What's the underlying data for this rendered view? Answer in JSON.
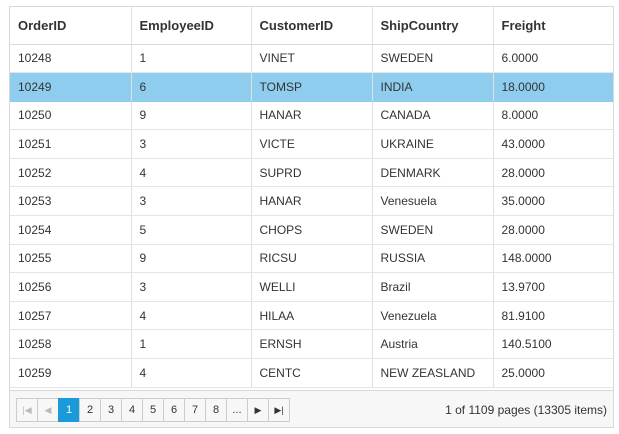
{
  "columns": [
    "OrderID",
    "EmployeeID",
    "CustomerID",
    "ShipCountry",
    "Freight"
  ],
  "rows": [
    [
      "10248",
      "1",
      "VINET",
      "SWEDEN",
      "6.0000"
    ],
    [
      "10249",
      "6",
      "TOMSP",
      "INDIA",
      "18.0000"
    ],
    [
      "10250",
      "9",
      "HANAR",
      "CANADA",
      "8.0000"
    ],
    [
      "10251",
      "3",
      "VICTE",
      "UKRAINE",
      "43.0000"
    ],
    [
      "10252",
      "4",
      "SUPRD",
      "DENMARK",
      "28.0000"
    ],
    [
      "10253",
      "3",
      "HANAR",
      "Venesuela",
      "35.0000"
    ],
    [
      "10254",
      "5",
      "CHOPS",
      "SWEDEN",
      "28.0000"
    ],
    [
      "10255",
      "9",
      "RICSU",
      "RUSSIA",
      "148.0000"
    ],
    [
      "10256",
      "3",
      "WELLI",
      "Brazil",
      "13.9700"
    ],
    [
      "10257",
      "4",
      "HILAA",
      "Venezuela",
      "81.9100"
    ],
    [
      "10258",
      "1",
      "ERNSH",
      "Austria",
      "140.5100"
    ],
    [
      "10259",
      "4",
      "CENTC",
      "NEW ZEASLAND",
      "25.0000"
    ]
  ],
  "selected_row": "10249",
  "pager": {
    "pages": [
      "1",
      "2",
      "3",
      "4",
      "5",
      "6",
      "7",
      "8",
      "..."
    ],
    "current_page": "1",
    "info": "1 of 1109 pages (13305 items)"
  },
  "icons": {
    "first": "first-page-icon",
    "prev": "previous-page-icon",
    "next": "next-page-icon",
    "last": "last-page-icon"
  },
  "colors": {
    "selected_row": "#8ecdee",
    "active_page": "#1a9ad9"
  }
}
